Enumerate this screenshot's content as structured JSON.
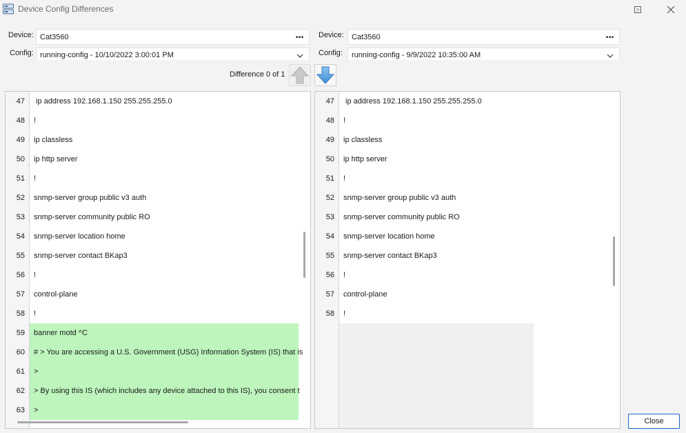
{
  "window": {
    "title": "Device Config Differences"
  },
  "left": {
    "device_label": "Device:",
    "device_value": "Cat3560",
    "config_label": "Config:",
    "config_value": "running-config - 10/10/2022 3:00:01 PM"
  },
  "right": {
    "device_label": "Device:",
    "device_value": "Cat3560",
    "config_label": "Config:",
    "config_value": "running-config - 9/9/2022 10:35:00 AM"
  },
  "browse_label": "...",
  "navigation": {
    "difference_text": "Difference 0 of 1"
  },
  "left_lines": [
    {
      "num": "47",
      "text": " ip address 192.168.1.150 255.255.255.0",
      "added": false
    },
    {
      "num": "48",
      "text": "!",
      "added": false
    },
    {
      "num": "49",
      "text": "ip classless",
      "added": false
    },
    {
      "num": "50",
      "text": "ip http server",
      "added": false
    },
    {
      "num": "51",
      "text": "!",
      "added": false
    },
    {
      "num": "52",
      "text": "snmp-server group public v3 auth",
      "added": false
    },
    {
      "num": "53",
      "text": "snmp-server community public RO",
      "added": false
    },
    {
      "num": "54",
      "text": "snmp-server location home",
      "added": false
    },
    {
      "num": "55",
      "text": "snmp-server contact BKap3",
      "added": false
    },
    {
      "num": "56",
      "text": "!",
      "added": false
    },
    {
      "num": "57",
      "text": "control-plane",
      "added": false
    },
    {
      "num": "58",
      "text": "!",
      "added": false
    },
    {
      "num": "59",
      "text": "banner motd ^C",
      "added": true
    },
    {
      "num": "60",
      "text": "# > You are accessing a U.S. Government (USG) Information System (IS) that is",
      "added": true
    },
    {
      "num": "61",
      "text": ">",
      "added": true
    },
    {
      "num": "62",
      "text": "> By using this IS (which includes any device attached to this IS), you consent t",
      "added": true
    },
    {
      "num": "63",
      "text": ">",
      "added": true
    }
  ],
  "right_lines": [
    {
      "num": "47",
      "text": " ip address 192.168.1.150 255.255.255.0"
    },
    {
      "num": "48",
      "text": "!"
    },
    {
      "num": "49",
      "text": "ip classless"
    },
    {
      "num": "50",
      "text": "ip http server"
    },
    {
      "num": "51",
      "text": "!"
    },
    {
      "num": "52",
      "text": "snmp-server group public v3 auth"
    },
    {
      "num": "53",
      "text": "snmp-server community public RO"
    },
    {
      "num": "54",
      "text": "snmp-server location home"
    },
    {
      "num": "55",
      "text": "snmp-server contact BKap3"
    },
    {
      "num": "56",
      "text": "!"
    },
    {
      "num": "57",
      "text": "control-plane"
    },
    {
      "num": "58",
      "text": "!"
    }
  ],
  "buttons": {
    "close_label": "Close"
  },
  "colors": {
    "added_background": "#bdf5bd",
    "close_border": "#1a66cc",
    "down_arrow": "#4a9de0"
  }
}
